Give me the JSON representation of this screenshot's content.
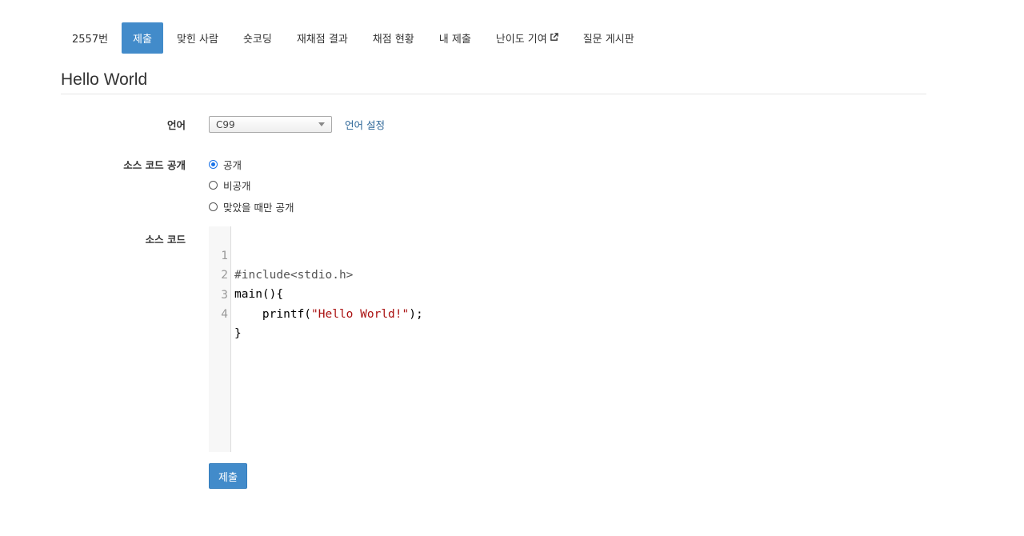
{
  "tabs": [
    {
      "label": "2557번",
      "active": false
    },
    {
      "label": "제출",
      "active": true
    },
    {
      "label": "맞힌 사람",
      "active": false
    },
    {
      "label": "숏코딩",
      "active": false
    },
    {
      "label": "재채점 결과",
      "active": false
    },
    {
      "label": "채점 현황",
      "active": false
    },
    {
      "label": "내 제출",
      "active": false
    },
    {
      "label": "난이도 기여",
      "active": false
    },
    {
      "label": "질문 게시판",
      "active": false
    }
  ],
  "title": "Hello World",
  "form": {
    "language_label": "언어",
    "language_selected": "C99",
    "language_settings_link": "언어 설정",
    "visibility_label": "소스 코드 공개",
    "visibility_options": [
      {
        "label": "공개",
        "checked": true
      },
      {
        "label": "비공개",
        "checked": false
      },
      {
        "label": "맞았을 때만 공개",
        "checked": false
      }
    ],
    "source_label": "소스 코드",
    "code_lines": [
      {
        "no": "1",
        "text": "#include<stdio.h>"
      },
      {
        "no": "2",
        "text": "main(){"
      },
      {
        "no": "3",
        "text": "    printf(\"Hello World!\");"
      },
      {
        "no": "4",
        "text": "}"
      }
    ],
    "submit_label": "제출"
  },
  "colors": {
    "accent": "#428bca",
    "link": "#2a6496",
    "radio_checked": "#1a73e8",
    "string_literal": "#aa1111"
  },
  "icons": {
    "external_link": "external-link-icon",
    "select_caret": "chevron-down-icon"
  }
}
